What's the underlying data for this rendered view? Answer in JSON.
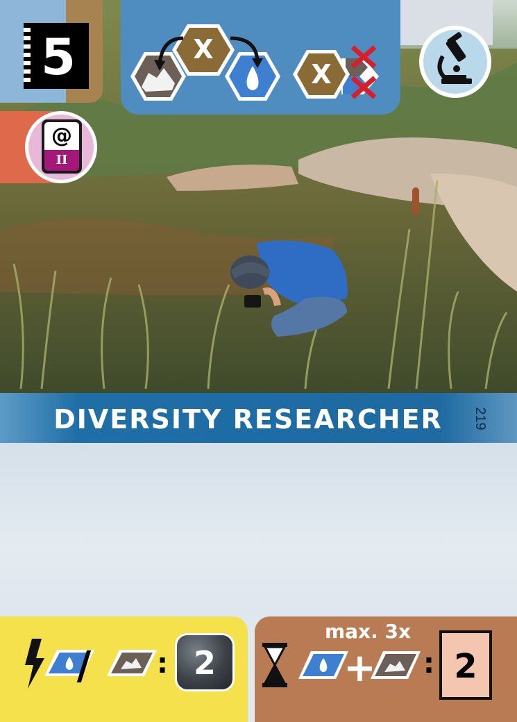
{
  "card": {
    "title": "DIVERSITY RESEARCHER",
    "number": "219",
    "cost": "5"
  },
  "tag": {
    "symbol": "@",
    "era": "II"
  },
  "top_effect": {
    "hex_symbol_1": "X",
    "hex_symbol_2": "X"
  },
  "bottom_left": {
    "reward": "2",
    "separator": "/",
    "colon": ":"
  },
  "bottom_right": {
    "limit": "max. 3x",
    "plus": "+",
    "colon": ":",
    "reward": "2"
  },
  "colors": {
    "blue_panel": "#4f8dc0",
    "title_band": "#1e6aa1",
    "yellow_box": "#f4e14b",
    "brown_box": "#b87b54",
    "red_tab": "#de6a4b",
    "hex_brown": "#8a6a35"
  },
  "icons": {
    "top_right": "microscope-icon",
    "tag": "at-sign-badge-icon",
    "bottom_left_left": "lightning-icon",
    "bottom_right_left": "hourglass-icon"
  }
}
